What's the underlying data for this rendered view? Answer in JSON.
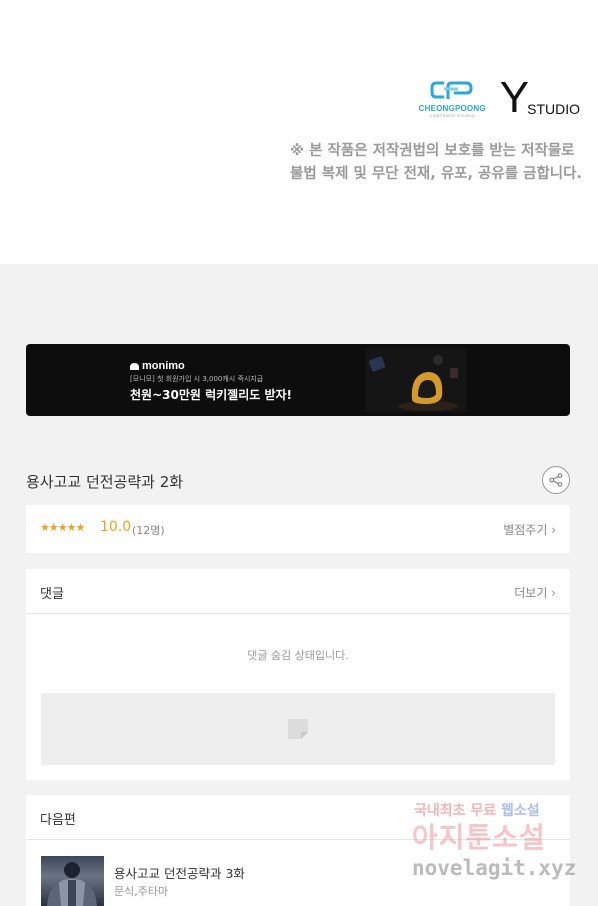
{
  "logos": {
    "cp_name": "CHEONGPOONG",
    "cp_sub": "CONTENTS STUDIO",
    "ys_letter": "Y",
    "ys_studio": "STUDIO"
  },
  "copyright": {
    "line1": "※ 본 작품은 저작권법의 보호를 받는 저작물로",
    "line2": "불법 복제 및 무단 전재, 유포, 공유를 금합니다."
  },
  "banner": {
    "brand": "monimo",
    "sub": "[모니모] 첫 회원가입 시 3,000캐시 즉시지급",
    "headline": "천원~30만원 럭키젤리도 받자!"
  },
  "episode": {
    "title": "용사고교 던전공략과 2화"
  },
  "rating": {
    "stars": "★★★★★",
    "score": "10.0",
    "count": "(12명)",
    "rate_label": "별점주기 ›"
  },
  "comments": {
    "title": "댓글",
    "more_label": "더보기 ›",
    "hidden_message": "댓글 숨김 상태입니다."
  },
  "next": {
    "title": "다음편",
    "item_title": "용사고교 던전공략과 3화",
    "item_author": "문식,주타마"
  },
  "watermark": {
    "line1a": "국내최초 무료 ",
    "line1b": "웹소설",
    "line2": "아지툰소설",
    "line3": "novelagit.xyz"
  },
  "icons": {
    "share": "share-icon",
    "comment_placeholder": "comment-placeholder-icon"
  },
  "colors": {
    "accent_star": "#f0a020",
    "banner_bg": "#0d0d0d",
    "page_bg": "#f2f2f2"
  }
}
